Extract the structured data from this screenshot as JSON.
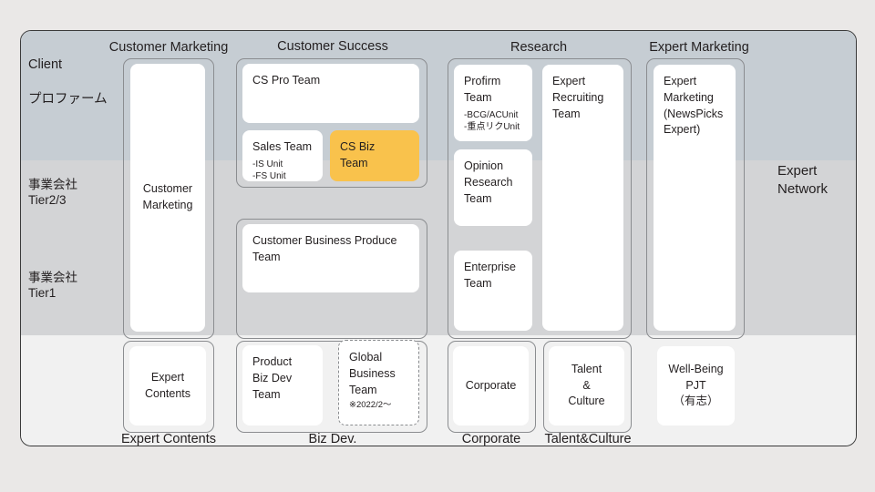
{
  "frame": {
    "row_labels": [
      {
        "id": "client",
        "text": "Client"
      },
      {
        "id": "profirm",
        "text": "プロファーム"
      },
      {
        "id": "tier23",
        "text": "事業会社\nTier2/3"
      },
      {
        "id": "tier1",
        "text": "事業会社\nTier1"
      }
    ],
    "free_labels": [
      {
        "id": "expert-network",
        "text": "Expert\nNetwork"
      }
    ]
  },
  "column_captions": [
    {
      "id": "customer-marketing",
      "text": "Customer Marketing"
    },
    {
      "id": "customer-success",
      "text": "Customer Success"
    },
    {
      "id": "research",
      "text": "Research"
    },
    {
      "id": "expert-marketing",
      "text": "Expert Marketing"
    }
  ],
  "bottom_captions": [
    {
      "id": "expert-contents",
      "text": "Expert Contents"
    },
    {
      "id": "biz-dev",
      "text": "Biz Dev."
    },
    {
      "id": "corporate",
      "text": "Corporate"
    },
    {
      "id": "talent-culture",
      "text": "Talent&Culture"
    }
  ],
  "cards": {
    "customer_marketing": {
      "title": "Customer\nMarketing"
    },
    "cs_pro_team": {
      "title": "CS Pro Team"
    },
    "sales_team": {
      "title": "Sales Team",
      "subs": "-IS Unit\n-FS Unit"
    },
    "cs_biz_team": {
      "title": "CS Biz\nTeam"
    },
    "customer_business_produce_team": {
      "title": "Customer Business Produce\nTeam"
    },
    "profirm_team": {
      "title": "Profirm\nTeam",
      "subs": "-BCG/ACUnit\n-重点リクUnit"
    },
    "opinion_research_team": {
      "title": "Opinion\nResearch\nTeam"
    },
    "enterprise_team": {
      "title": "Enterprise\nTeam"
    },
    "expert_recruiting_team": {
      "title": "Expert\nRecruiting\nTeam"
    },
    "expert_marketing": {
      "title": "Expert\nMarketing\n(NewsPicks\nExpert)"
    },
    "expert_contents": {
      "title": "Expert\nContents"
    },
    "product_biz_dev_team": {
      "title": "Product\nBiz Dev\nTeam"
    },
    "global_business_team": {
      "title": "Global\nBusiness\nTeam",
      "note": "※2022/2〜"
    },
    "corporate_card": {
      "title": "Corporate"
    },
    "talent_culture_card": {
      "title": "Talent\n&\nCulture"
    },
    "well_being_pjt": {
      "title": "Well-Being\nPJT\n（有志）"
    }
  },
  "colors": {
    "band_client": "#c6cdd3",
    "band_tier23": "#d3d4d6",
    "band_tier1": "#f1f1f1",
    "accent": "#f9c24c",
    "page_bg": "#eae8e7",
    "outline": "#8b8d90"
  }
}
